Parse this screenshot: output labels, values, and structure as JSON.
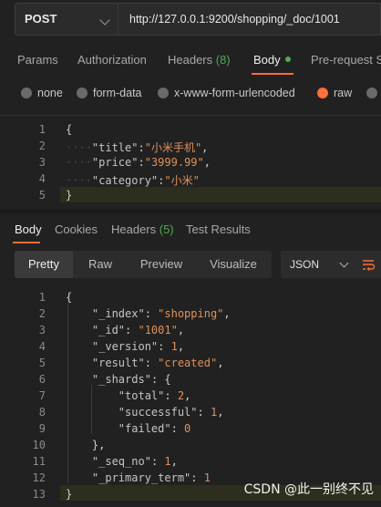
{
  "request": {
    "method": "POST",
    "url": "http://127.0.0.1:9200/shopping/_doc/1001"
  },
  "request_tabs": [
    {
      "label": "Params"
    },
    {
      "label": "Authorization"
    },
    {
      "label": "Headers ",
      "count": "(8)"
    },
    {
      "label": "Body"
    },
    {
      "label": "Pre-request S"
    }
  ],
  "body_types": [
    {
      "label": "none",
      "selected": false
    },
    {
      "label": "form-data",
      "selected": false
    },
    {
      "label": "x-www-form-urlencoded",
      "selected": false
    },
    {
      "label": "raw",
      "selected": true
    }
  ],
  "request_body": {
    "line_numbers": [
      "1",
      "2",
      "3",
      "4",
      "5"
    ],
    "title_key": "\"title\"",
    "title_value": "\"小米手机\"",
    "price_key": "\"price\"",
    "price_value": "\"3999.99\"",
    "category_key": "\"category\"",
    "category_value": "\"小米\""
  },
  "response_tabs": [
    {
      "label": "Body"
    },
    {
      "label": "Cookies"
    },
    {
      "label": "Headers ",
      "count": "(5)"
    },
    {
      "label": "Test Results"
    }
  ],
  "response_views": [
    "Pretty",
    "Raw",
    "Preview",
    "Visualize"
  ],
  "response_format": "JSON",
  "response_body": {
    "line_numbers": [
      "1",
      "2",
      "3",
      "4",
      "5",
      "6",
      "7",
      "8",
      "9",
      "10",
      "11",
      "12",
      "13"
    ],
    "index_key": "\"_index\"",
    "index_value": "\"shopping\"",
    "id_key": "\"_id\"",
    "id_value": "\"1001\"",
    "version_key": "\"_version\"",
    "version_value": "1",
    "result_key": "\"result\"",
    "result_value": "\"created\"",
    "shards_key": "\"_shards\"",
    "total_key": "\"total\"",
    "total_value": "2",
    "successful_key": "\"successful\"",
    "successful_value": "1",
    "failed_key": "\"failed\"",
    "failed_value": "0",
    "seq_no_key": "\"_seq_no\"",
    "seq_no_value": "1",
    "primary_term_key": "\"_primary_term\"",
    "primary_term_value": "1"
  },
  "watermark": "CSDN @此一别终不见",
  "colors": {
    "accent": "#ff6c37",
    "count_green": "#4caf50",
    "background": "#212121"
  }
}
